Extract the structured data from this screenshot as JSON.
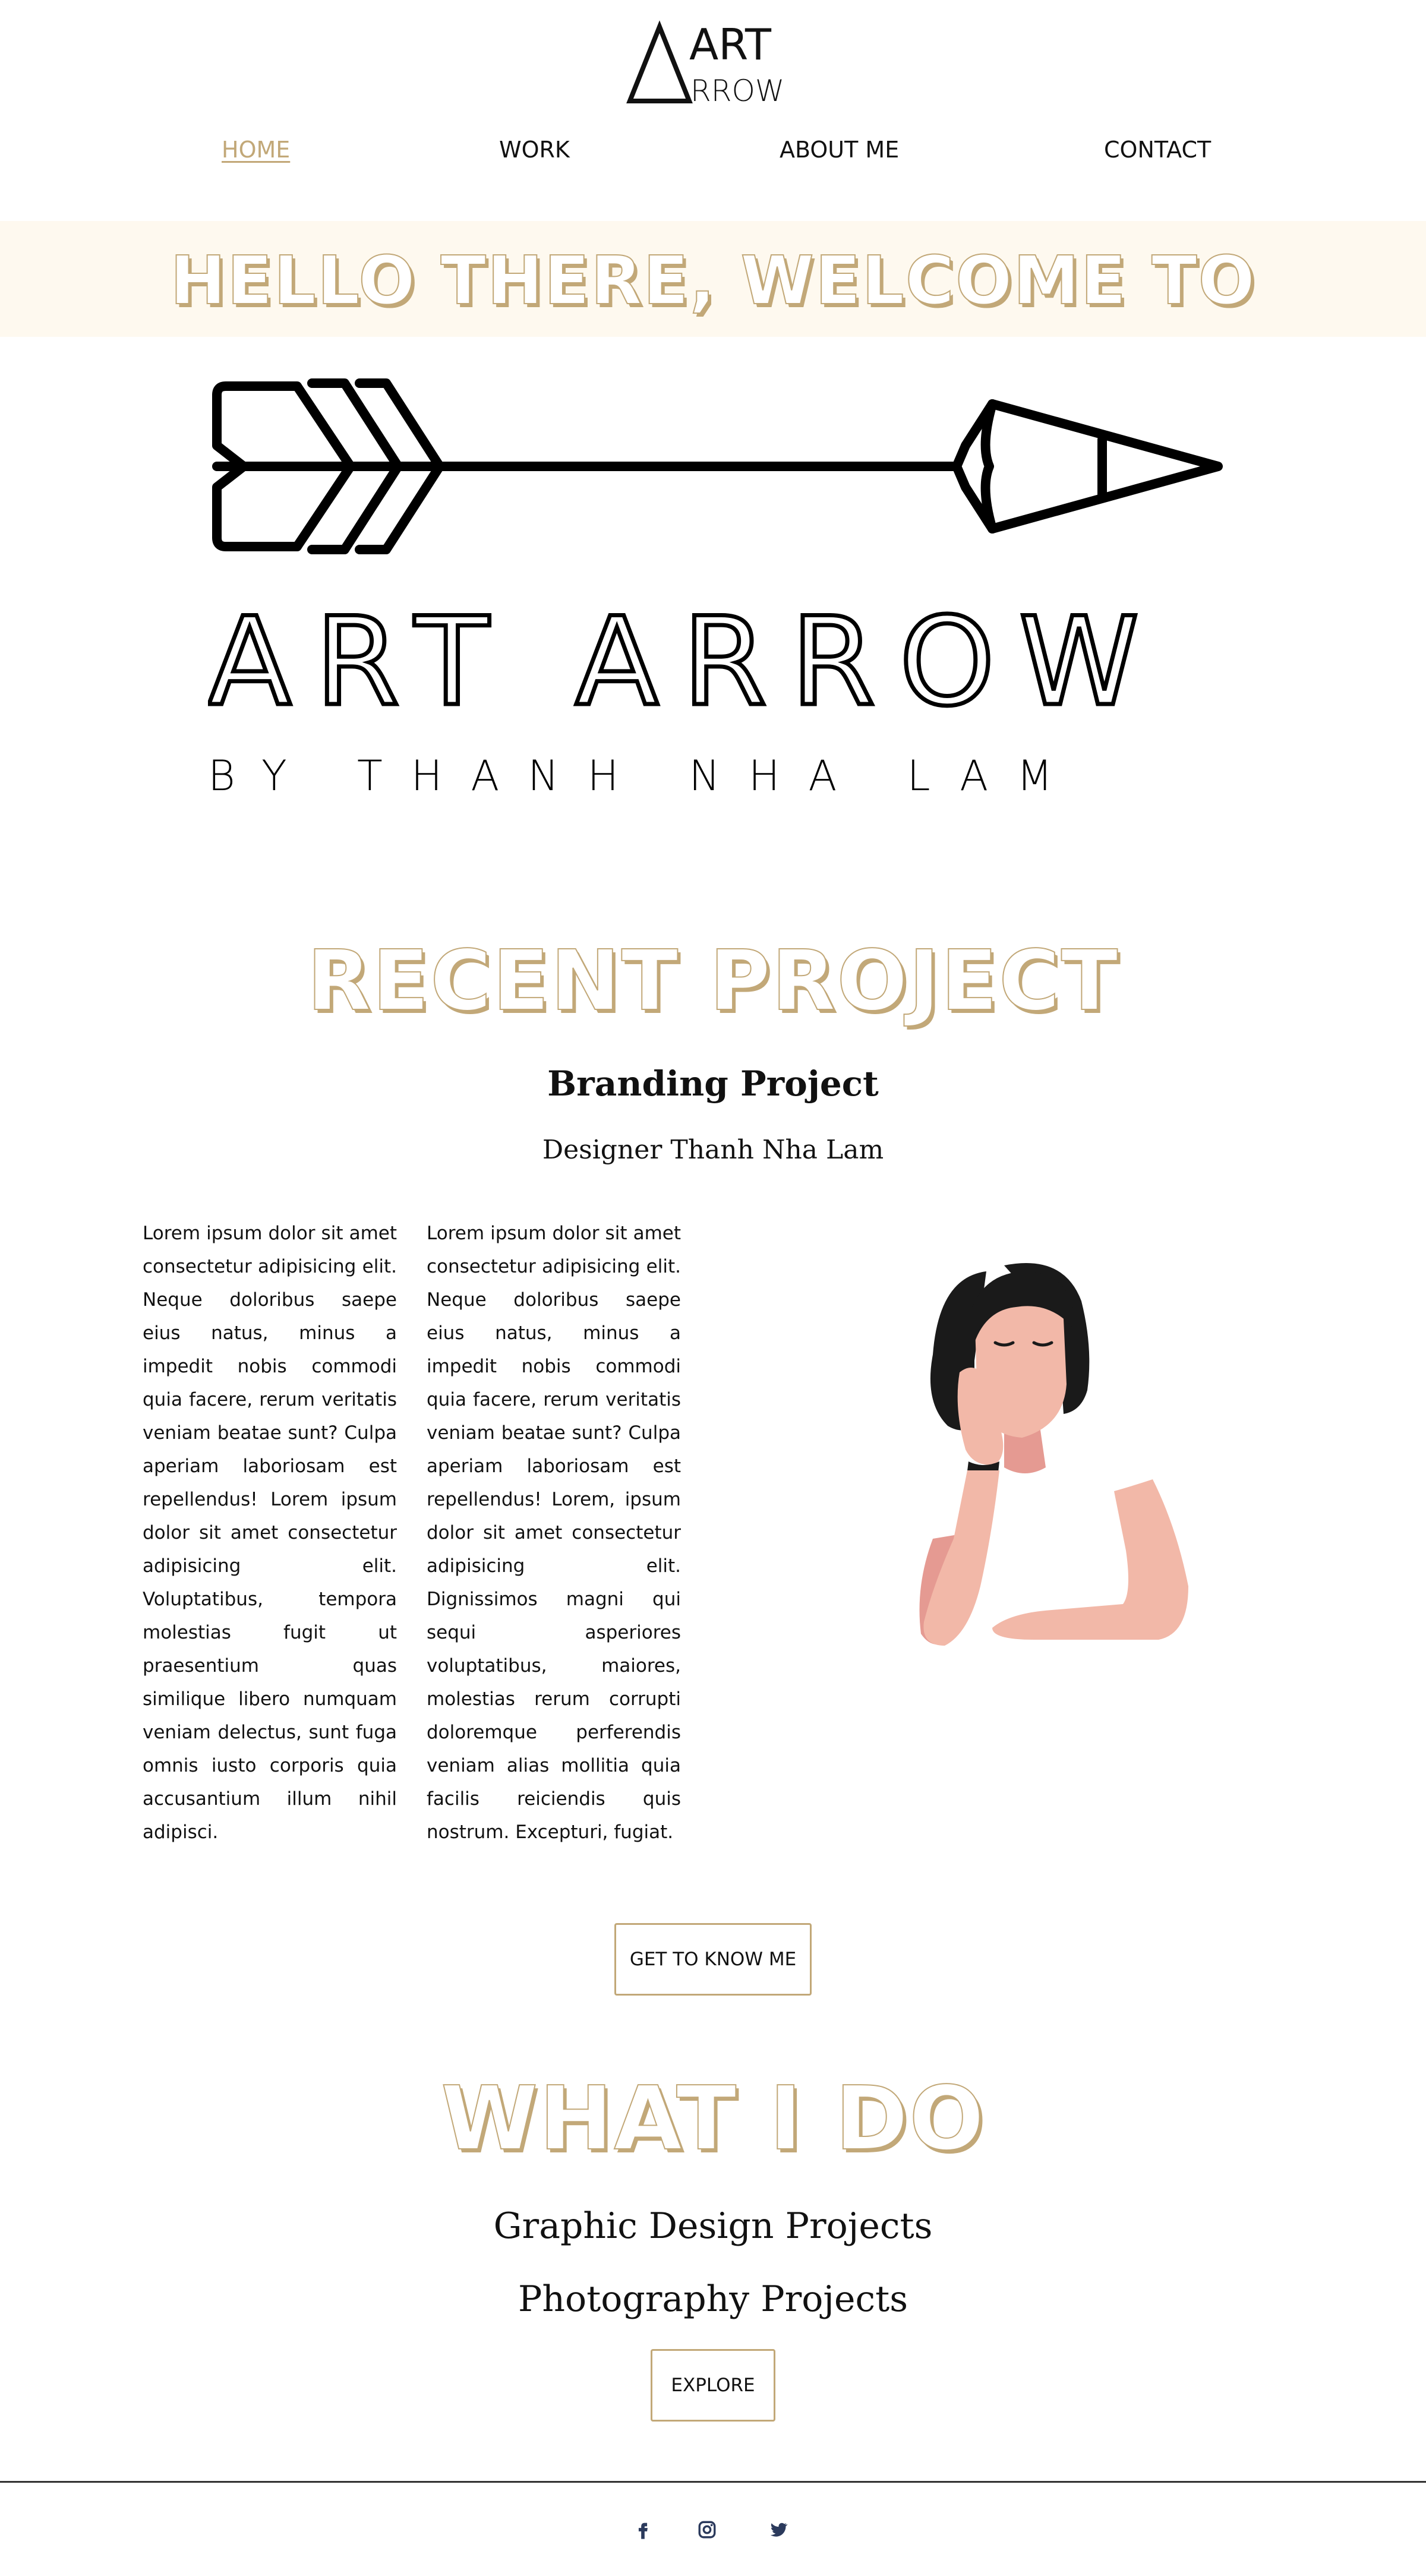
{
  "header": {
    "logo_top": "ART",
    "logo_bottom": "RROW",
    "nav": [
      {
        "label": "HOME",
        "active": true
      },
      {
        "label": "WORK",
        "active": false
      },
      {
        "label": "ABOUT ME",
        "active": false
      },
      {
        "label": "CONTACT",
        "active": false
      }
    ]
  },
  "hero": {
    "greeting": "HELLO THERE, WELCOME TO",
    "brand_name": "ART ARROW",
    "brand_byline": "BY THANH NHA LAM"
  },
  "recent_project": {
    "heading": "RECENT PROJECT",
    "title": "Branding Project",
    "subtitle": "Designer Thanh Nha Lam",
    "paragraph_1": "Lorem ipsum dolor sit amet consectetur adipisicing elit. Neque doloribus saepe eius natus, minus a impedit nobis commodi quia facere, rerum veritatis veniam beatae sunt? Culpa aperiam laboriosam est repellendus! Lorem ipsum dolor sit amet consectetur adipisicing elit. Voluptatibus, tempora molestias fugit ut praesentium quas similique libero numquam veniam delectus, sunt fuga omnis iusto corporis quia accusantium illum nihil adipisci.",
    "paragraph_2": "Lorem ipsum dolor sit amet consectetur adipisicing elit. Neque doloribus saepe eius natus, minus a impedit nobis commodi quia facere, rerum veritatis veniam beatae sunt? Culpa aperiam laboriosam est repellendus! Lorem, ipsum dolor sit amet consectetur adipisicing elit. Dignissimos magni qui sequi asperiores voluptatibus, maiores, molestias rerum corrupti doloremque perferendis veniam alias mollitia quia facilis reiciendis quis nostrum. Excepturi, fugiat.",
    "button_label": "GET TO KNOW ME"
  },
  "what_i_do": {
    "heading": "WHAT I DO",
    "services": [
      "Graphic Design Projects",
      "Photography Projects"
    ],
    "button_label": "EXPLORE"
  },
  "footer": {
    "social_icons": [
      "facebook-icon",
      "instagram-icon",
      "twitter-icon"
    ]
  },
  "colors": {
    "accent": "#c2a878",
    "hero_band": "#fef9ef",
    "text": "#111111",
    "social": "#2b3a5c",
    "hair": "#1a1a1a",
    "skin": "#f2b8a8"
  }
}
